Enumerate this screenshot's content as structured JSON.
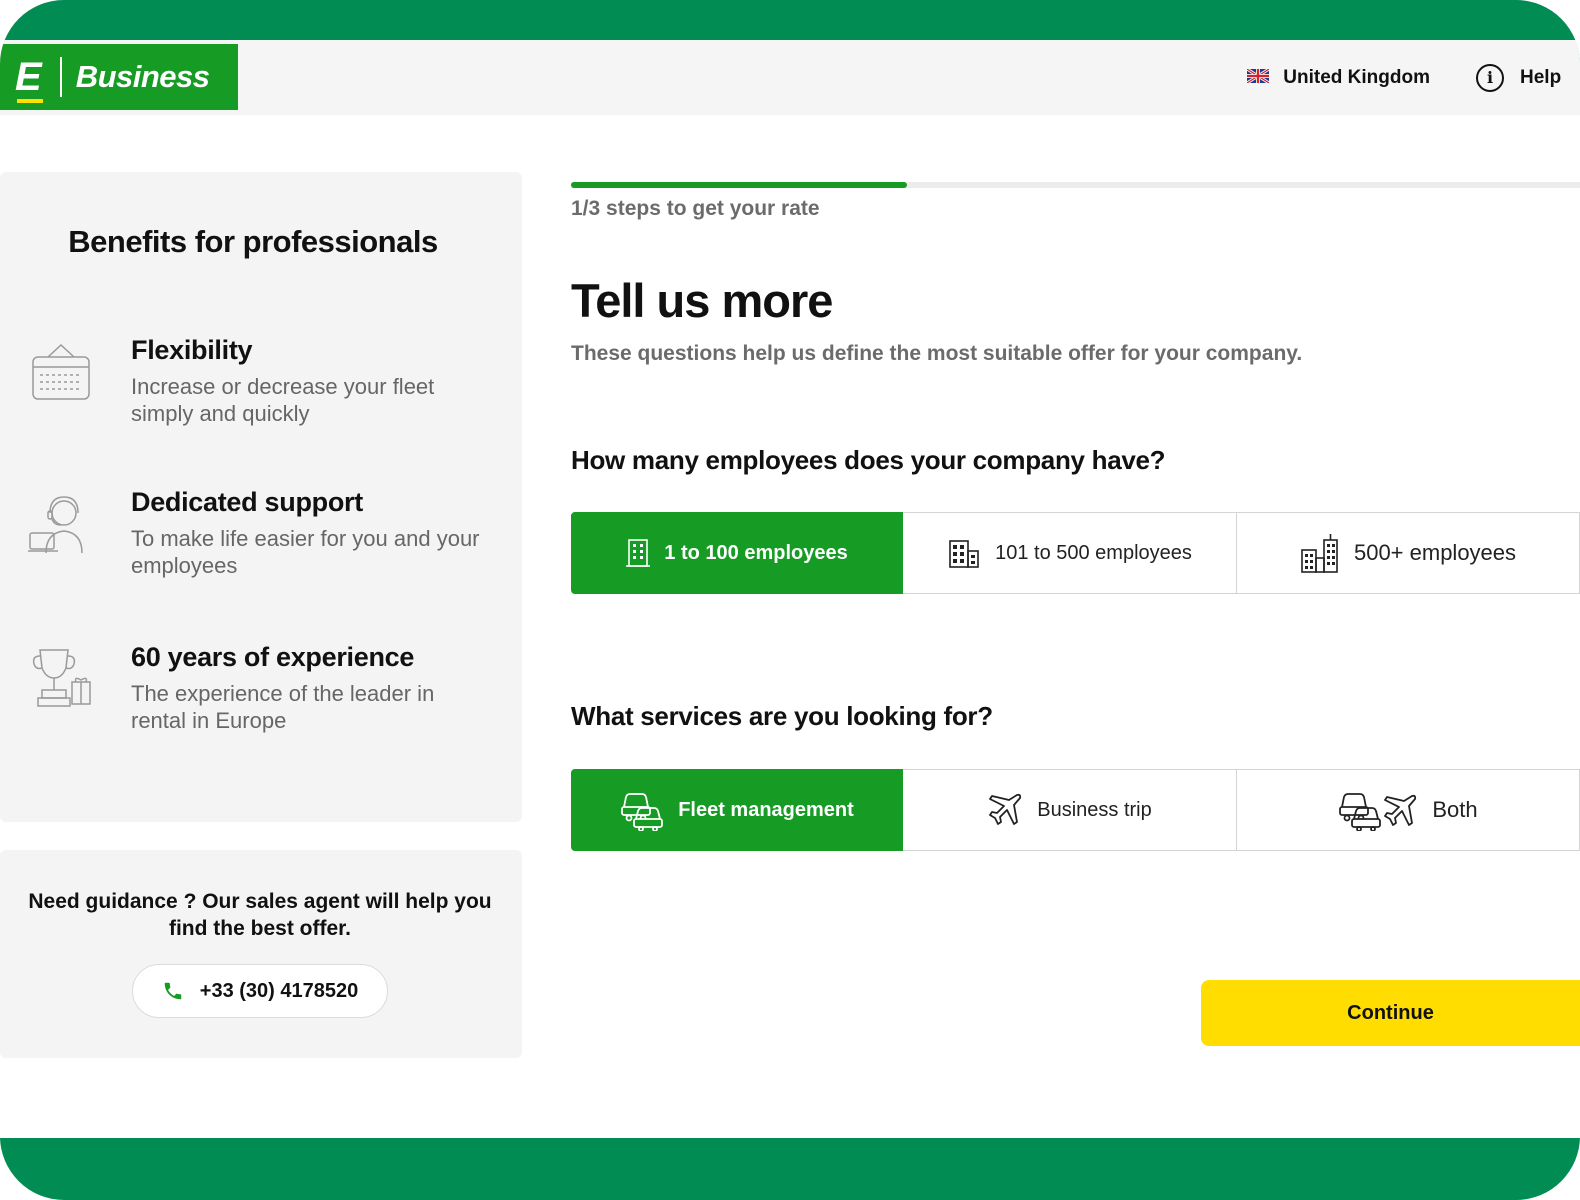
{
  "brand": {
    "logo_letter": "E",
    "logo_text": "Business",
    "green": "#169b24",
    "frame_green": "#008c52",
    "accent_yellow": "#ffdd00"
  },
  "header": {
    "country": "United Kingdom",
    "country_icon": "uk-flag-icon",
    "help": "Help",
    "help_icon": "info-icon"
  },
  "benefits": {
    "title": "Benefits for professionals",
    "items": [
      {
        "icon": "calendar-icon",
        "title": "Flexibility",
        "desc": "Increase or decrease your fleet simply and quickly"
      },
      {
        "icon": "support-agent-icon",
        "title": "Dedicated support",
        "desc": "To make life easier for you and your employees"
      },
      {
        "icon": "trophy-icon",
        "title": "60 years of experience",
        "desc": "The experience of the leader in rental in Europe"
      }
    ]
  },
  "guidance": {
    "text": "Need guidance ? Our sales agent will help you find the best offer.",
    "phone": "+33 (30) 4178520",
    "phone_icon": "phone-icon"
  },
  "form": {
    "progress": 0.333,
    "steps_label": "1/3 steps to get your rate",
    "title": "Tell us more",
    "subtitle": "These questions help us define the most suitable offer for your company.",
    "employees": {
      "question": "How many employees does your company have?",
      "options": [
        {
          "label": "1 to 100 employees",
          "icon": "small-building-icon",
          "selected": true
        },
        {
          "label": "101 to 500 employees",
          "icon": "medium-building-icon",
          "selected": false
        },
        {
          "label": "500+ employees",
          "icon": "large-buildings-icon",
          "selected": false
        }
      ]
    },
    "services": {
      "question": "What services are you looking for?",
      "options": [
        {
          "label": "Fleet management",
          "icon": "cars-icon",
          "selected": true
        },
        {
          "label": "Business trip",
          "icon": "plane-icon",
          "selected": false
        },
        {
          "label": "Both",
          "icon": "cars-plane-icon",
          "selected": false
        }
      ]
    },
    "continue_label": "Continue"
  }
}
